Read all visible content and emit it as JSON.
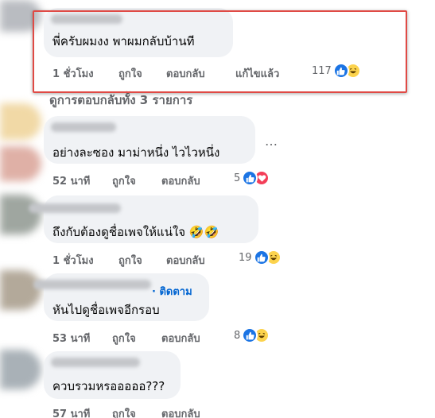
{
  "comments": [
    {
      "text": "พี่ครับผมงง พาผมกลับบ้านที",
      "time": "1 ชั่วโมง",
      "like": "ถูกใจ",
      "reply": "ตอบกลับ",
      "edited": "แก้ไขแล้ว",
      "reactions": "117",
      "reaction_icons": [
        "like-icon",
        "haha-icon"
      ]
    },
    {
      "text": "อย่างละซอง มาม่าหนึ่ง ไวไวหนึ่ง",
      "time": "52 นาที",
      "like": "ถูกใจ",
      "reply": "ตอบกลับ",
      "reactions": "5",
      "reaction_icons": [
        "like-icon",
        "love-icon"
      ]
    },
    {
      "text": "ถึงกับต้องดูชื่อเพจให้แน่ใจ 🤣🤣",
      "time": "1 ชั่วโมง",
      "like": "ถูกใจ",
      "reply": "ตอบกลับ",
      "reactions": "19",
      "reaction_icons": [
        "like-icon",
        "haha-icon"
      ]
    },
    {
      "follow": "· ติดตาม",
      "text": "หันไปดูชื่อเพจอีกรอบ",
      "time": "53 นาที",
      "like": "ถูกใจ",
      "reply": "ตอบกลับ",
      "reactions": "8",
      "reaction_icons": [
        "like-icon",
        "haha-icon"
      ]
    },
    {
      "text": "ควบรวมหรอออออ???",
      "time": "57 นาที",
      "like": "ถูกใจ",
      "reply": "ตอบกลับ"
    }
  ],
  "view_replies": "ดูการตอบกลับทั้ง 3 รายการ",
  "more_icon": "…",
  "colors": {
    "bubble": "#f0f2f5",
    "meta": "#65676b",
    "link": "#0064d1",
    "highlight": "#e04a45",
    "like": "#1b74e4",
    "love": "#f33e58",
    "haha": "#fcd34d"
  }
}
